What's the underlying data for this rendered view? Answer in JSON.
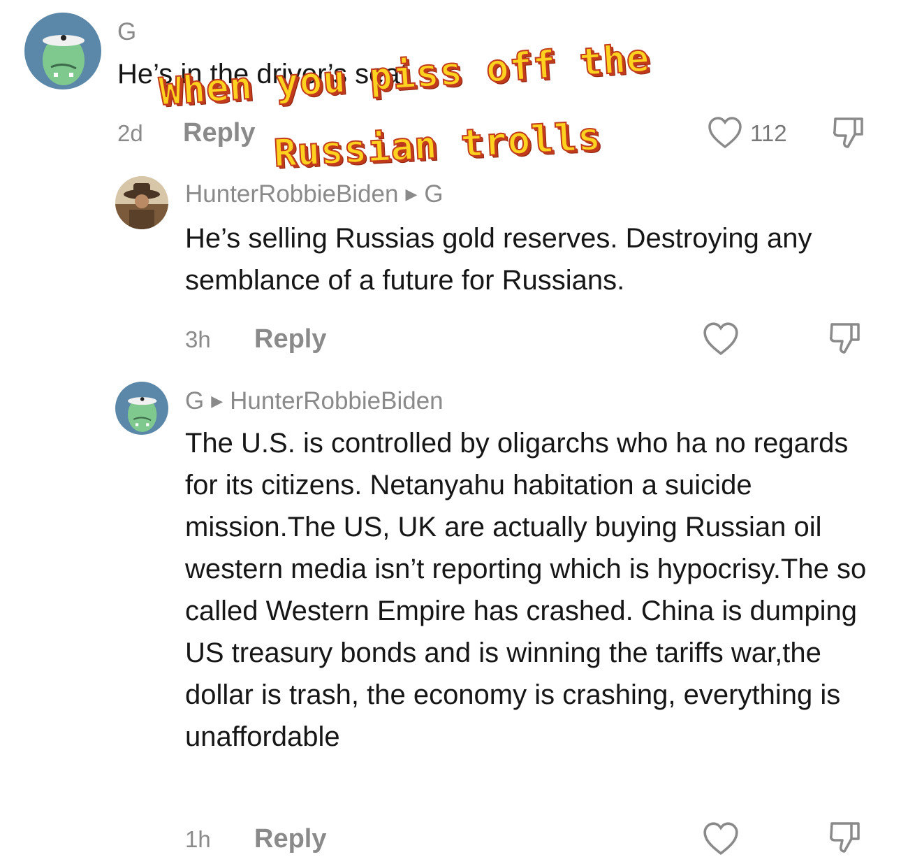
{
  "comments": [
    {
      "username": "G",
      "text": "He’s in the driver’s seat",
      "time": "2d",
      "reply_label": "Reply",
      "like_count": "112",
      "avatar": "green-frog-avatar-icon"
    },
    {
      "username": "HunterRobbieBiden",
      "reply_to": "G",
      "text": "He’s selling Russias gold reserves. Destroying any semblance of a future for Russians.",
      "time": "3h",
      "reply_label": "Reply",
      "avatar": "cowboy-photo-avatar"
    },
    {
      "username": "G",
      "reply_to": "HunterRobbieBiden",
      "text": "The U.S. is controlled by oligarchs who ha no regards for its citizens. Netanyahu habitation a suicide mission.The US, UK are actually buying Russian oil western media isn’t reporting which is hypocrisy.The so called Western Empire has crashed. China is dumping US treasury bonds and is winning the tariffs war,the dollar is trash, the economy is crashing, everything is unaffordable",
      "time": "1h",
      "reply_label": "Reply",
      "avatar": "green-frog-avatar-icon"
    }
  ],
  "overlay_caption": {
    "line1": "When you piss off the",
    "line2": "Russian trolls"
  },
  "colors": {
    "caption_fill": "#ffd21f",
    "caption_outline": "#c23a1c",
    "avatar_bg": "#5b87a8",
    "frog_green": "#7fc98f",
    "meta_gray": "#8a8a8a"
  }
}
